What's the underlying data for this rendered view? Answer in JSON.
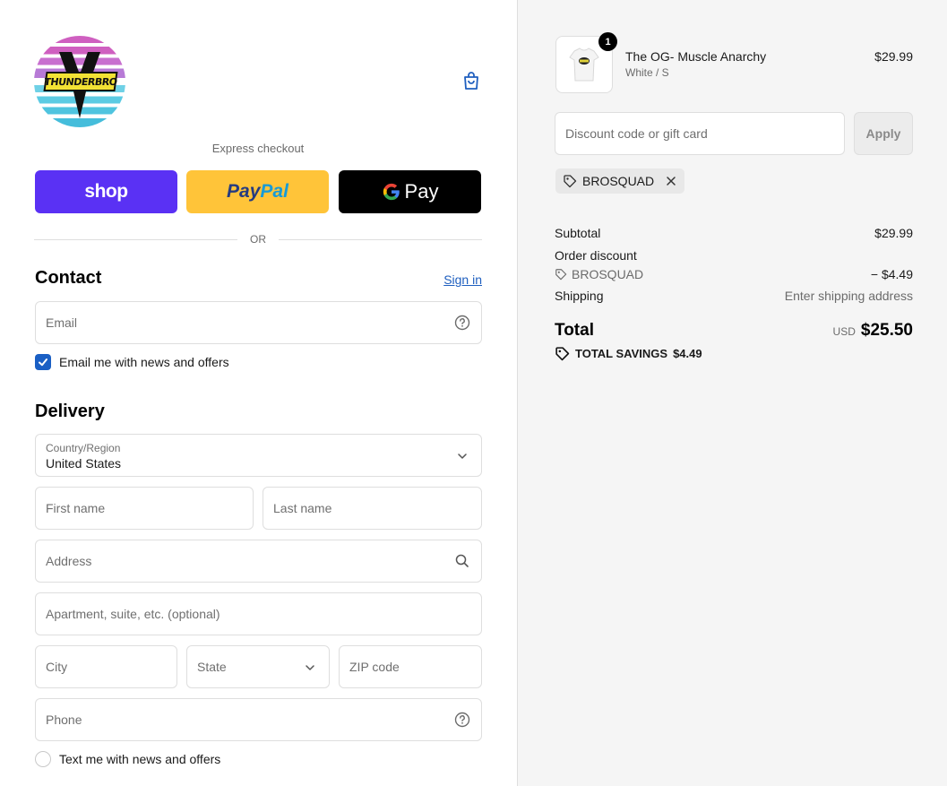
{
  "brand": {
    "logo_text": "THUNDERBRO"
  },
  "express": {
    "label": "Express checkout",
    "shop_label": "shop",
    "paypal_pay": "Pay",
    "paypal_pal": "Pal",
    "gpay_g": "G",
    "gpay_label": "Pay",
    "or_label": "OR"
  },
  "contact": {
    "heading": "Contact",
    "sign_in": "Sign in",
    "email_placeholder": "Email",
    "email_optin_label": "Email me with news and offers",
    "email_optin_checked": true
  },
  "delivery": {
    "heading": "Delivery",
    "country_label": "Country/Region",
    "country_value": "United States",
    "first_name_placeholder": "First name",
    "last_name_placeholder": "Last name",
    "address_placeholder": "Address",
    "apartment_placeholder": "Apartment, suite, etc. (optional)",
    "city_placeholder": "City",
    "state_placeholder": "State",
    "zip_placeholder": "ZIP code",
    "phone_placeholder": "Phone",
    "sms_optin_label": "Text me with news and offers",
    "sms_optin_checked": false
  },
  "order": {
    "item": {
      "quantity": "1",
      "name": "The OG- Muscle Anarchy",
      "variant": "White / S",
      "price": "$29.99"
    },
    "discount_placeholder": "Discount code or gift card",
    "apply_label": "Apply",
    "applied_code": "BROSQUAD",
    "summary": {
      "subtotal_label": "Subtotal",
      "subtotal_value": "$29.99",
      "discount_label": "Order discount",
      "discount_code": "BROSQUAD",
      "discount_value": "− $4.49",
      "shipping_label": "Shipping",
      "shipping_value": "Enter shipping address",
      "total_label": "Total",
      "total_currency": "USD",
      "total_value": "$25.50",
      "savings_label": "TOTAL SAVINGS",
      "savings_value": "$4.49"
    }
  },
  "colors": {
    "shop_purple": "#5a31f4",
    "paypal_yellow": "#ffc439",
    "link_blue": "#1f5fbf",
    "checkbox_blue": "#1a5fc4"
  }
}
